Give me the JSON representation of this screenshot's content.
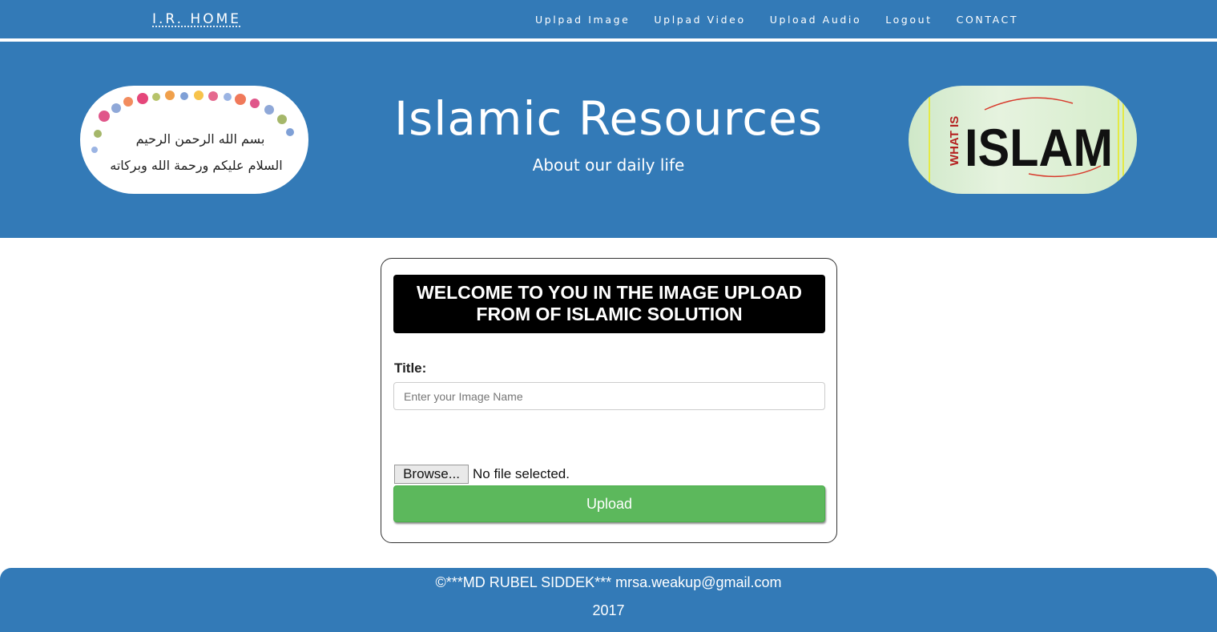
{
  "navbar": {
    "brand": "I.R. HOME",
    "links": [
      "Uplpad Image",
      "Uplpad Video",
      "Upload Audio",
      "Logout",
      "CONTACT"
    ]
  },
  "hero": {
    "title": "Islamic Resources",
    "subtitle": "About our daily life",
    "left_image": {
      "line1": "بسم الله الرحمن الرحيم",
      "line2": "السلام عليكم ورحمة الله وبركاته"
    },
    "right_image": {
      "small": "WHAT IS",
      "big": "ISLAM"
    }
  },
  "form": {
    "header": "WELCOME TO YOU IN THE IMAGE UPLOAD FROM OF ISLAMIC SOLUTION",
    "title_label": "Title:",
    "title_placeholder": "Enter your Image Name",
    "browse_label": "Browse...",
    "file_status": "No file selected.",
    "upload_label": "Upload"
  },
  "footer": {
    "line1": "©***MD RUBEL SIDDEK*** mrsa.weakup@gmail.com",
    "line2": "2017"
  },
  "colors": {
    "primary": "#337ab7",
    "success": "#5cb85c",
    "header_bg": "#000000"
  }
}
